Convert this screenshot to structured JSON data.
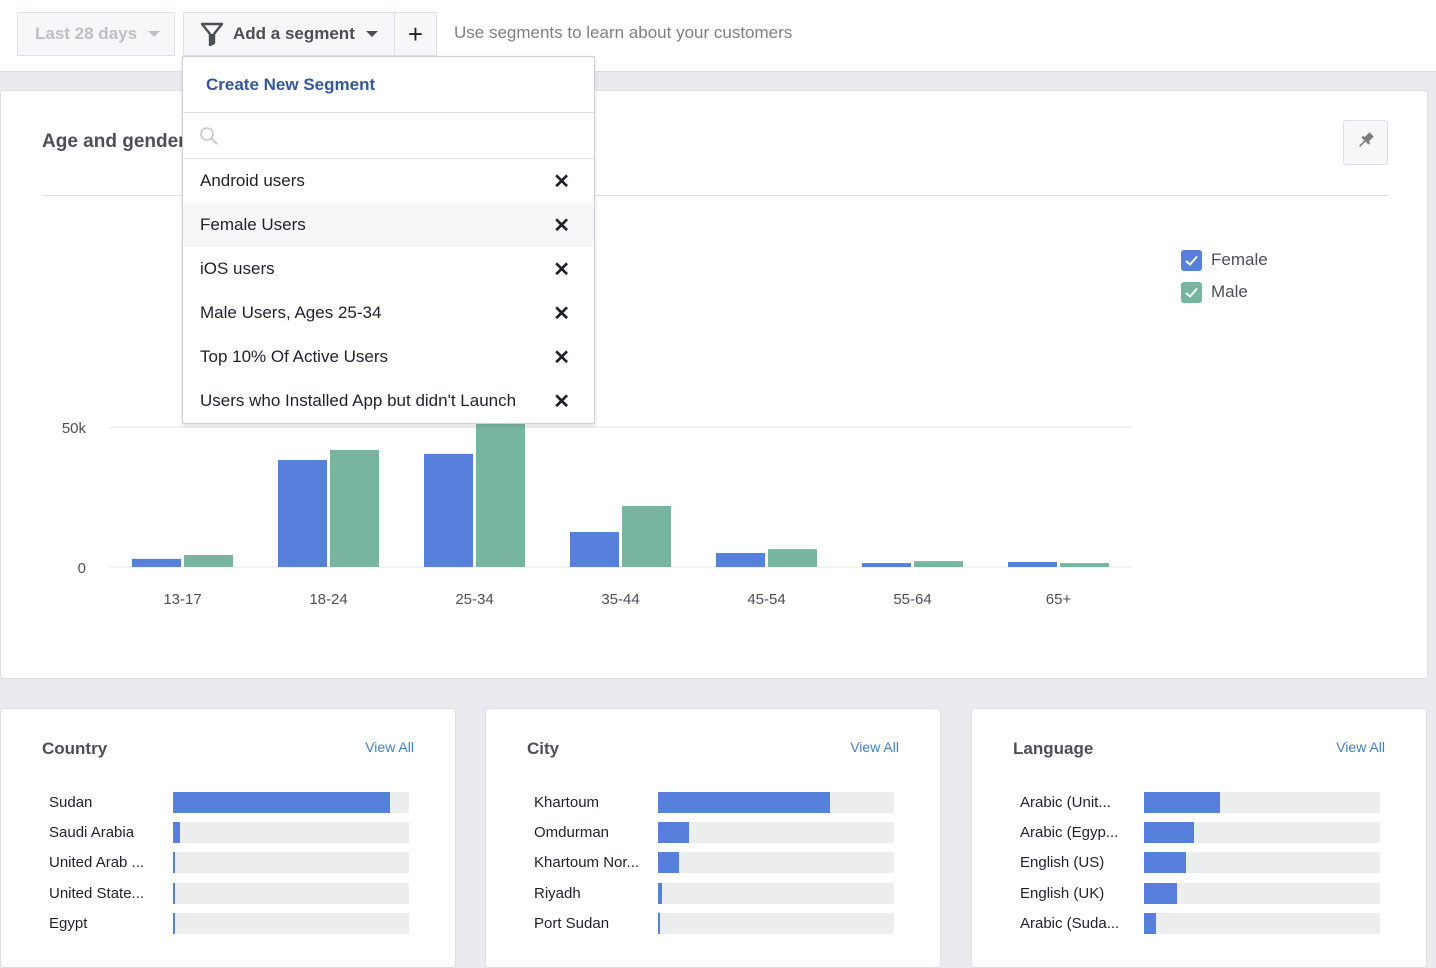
{
  "toolbar": {
    "date_range": "Last 28 days",
    "add_segment": "Add a segment",
    "add_label": "+",
    "hint": "Use segments to learn about your customers"
  },
  "segment_dropdown": {
    "create_label": "Create New Segment",
    "search_value": "",
    "search_placeholder": "",
    "items": [
      {
        "label": "Android users",
        "highlighted": false
      },
      {
        "label": "Female Users",
        "highlighted": true
      },
      {
        "label": "iOS users",
        "highlighted": false
      },
      {
        "label": "Male Users, Ages 25-34",
        "highlighted": false
      },
      {
        "label": "Top 10% Of Active Users",
        "highlighted": false
      },
      {
        "label": "Users who Installed App but didn't Launch",
        "highlighted": false
      }
    ],
    "remove_glyph": "✕"
  },
  "age_gender": {
    "title": "Age and gender",
    "legend": [
      {
        "label": "Female",
        "color": "#5680dc",
        "checked": true
      },
      {
        "label": "Male",
        "color": "#78b5a0",
        "checked": true
      }
    ]
  },
  "chart_data": {
    "type": "bar",
    "title": "Age and gender",
    "xlabel": "",
    "ylabel": "",
    "categories": [
      "13-17",
      "18-24",
      "25-34",
      "35-44",
      "45-54",
      "55-64",
      "65+"
    ],
    "series": [
      {
        "name": "Female",
        "color": "#5680dc",
        "values": [
          2900,
          38200,
          40400,
          12500,
          5000,
          1400,
          1800
        ]
      },
      {
        "name": "Male",
        "color": "#78b5a0",
        "values": [
          4300,
          41800,
          52000,
          21800,
          6400,
          2100,
          1400
        ]
      }
    ],
    "yticks": [
      {
        "value": 0,
        "label": "0"
      },
      {
        "value": 50000,
        "label": "50k"
      }
    ],
    "ylim": [
      0,
      50000
    ],
    "grid": true,
    "legend_position": "right"
  },
  "breakdowns": [
    {
      "title": "Country",
      "view_all": "View All",
      "rows": [
        {
          "label": "Sudan",
          "fraction": 0.92
        },
        {
          "label": "Saudi Arabia",
          "fraction": 0.03
        },
        {
          "label": "United Arab ...",
          "fraction": 0.01
        },
        {
          "label": "United State...",
          "fraction": 0.01
        },
        {
          "label": "Egypt",
          "fraction": 0.006
        }
      ]
    },
    {
      "title": "City",
      "view_all": "View All",
      "rows": [
        {
          "label": "Khartoum",
          "fraction": 0.73
        },
        {
          "label": "Omdurman",
          "fraction": 0.13
        },
        {
          "label": "Khartoum Nor...",
          "fraction": 0.09
        },
        {
          "label": "Riyadh",
          "fraction": 0.015
        },
        {
          "label": "Port Sudan",
          "fraction": 0.01
        }
      ]
    },
    {
      "title": "Language",
      "view_all": "View All",
      "rows": [
        {
          "label": "Arabic (Unit...",
          "fraction": 0.32
        },
        {
          "label": "Arabic (Egyp...",
          "fraction": 0.21
        },
        {
          "label": "English (US)",
          "fraction": 0.18
        },
        {
          "label": "English (UK)",
          "fraction": 0.14
        },
        {
          "label": "Arabic (Suda...",
          "fraction": 0.05
        }
      ]
    }
  ]
}
